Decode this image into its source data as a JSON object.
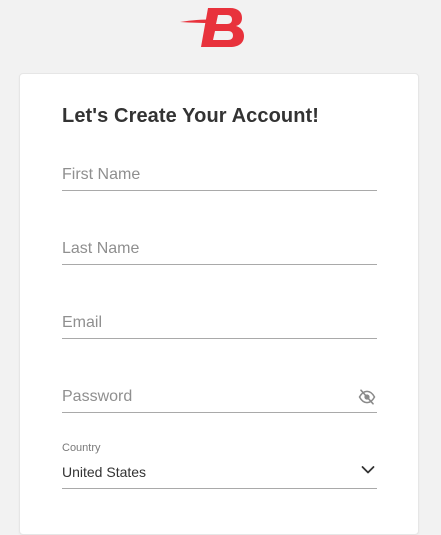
{
  "brand": {
    "logo_icon": "brand-b-logo",
    "color": "#e8323c"
  },
  "form": {
    "title": "Let's Create Your Account!",
    "first_name_placeholder": "First Name",
    "last_name_placeholder": "Last Name",
    "email_placeholder": "Email",
    "password_placeholder": "Password",
    "password_toggle_icon": "eye-slash-icon",
    "country_label": "Country",
    "country_value": "United States",
    "country_dropdown_icon": "chevron-down-icon"
  }
}
